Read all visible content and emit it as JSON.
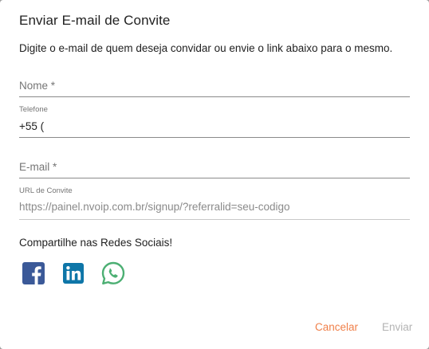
{
  "dialog": {
    "title": "Enviar E-mail de Convite",
    "subtitle": "Digite o e-mail de quem deseja convidar ou envie o link abaixo para o mesmo."
  },
  "form": {
    "nome": {
      "placeholder": "Nome *"
    },
    "telefone": {
      "label": "Telefone",
      "value": "+55 ("
    },
    "email": {
      "placeholder": "E-mail *"
    },
    "url": {
      "label": "URL de Convite",
      "value": "https://painel.nvoip.com.br/signup/?referralid=seu-codigo"
    }
  },
  "share": {
    "label": "Compartilhe nas Redes Sociais!",
    "icons": [
      {
        "name": "facebook-icon",
        "color": "#3b5998"
      },
      {
        "name": "linkedin-icon",
        "color": "#0e76a8"
      },
      {
        "name": "whatsapp-icon",
        "color": "#4caf73"
      }
    ]
  },
  "actions": {
    "cancel_label": "Cancelar",
    "send_label": "Enviar",
    "cancel_color": "#f0804a",
    "send_disabled": true
  }
}
